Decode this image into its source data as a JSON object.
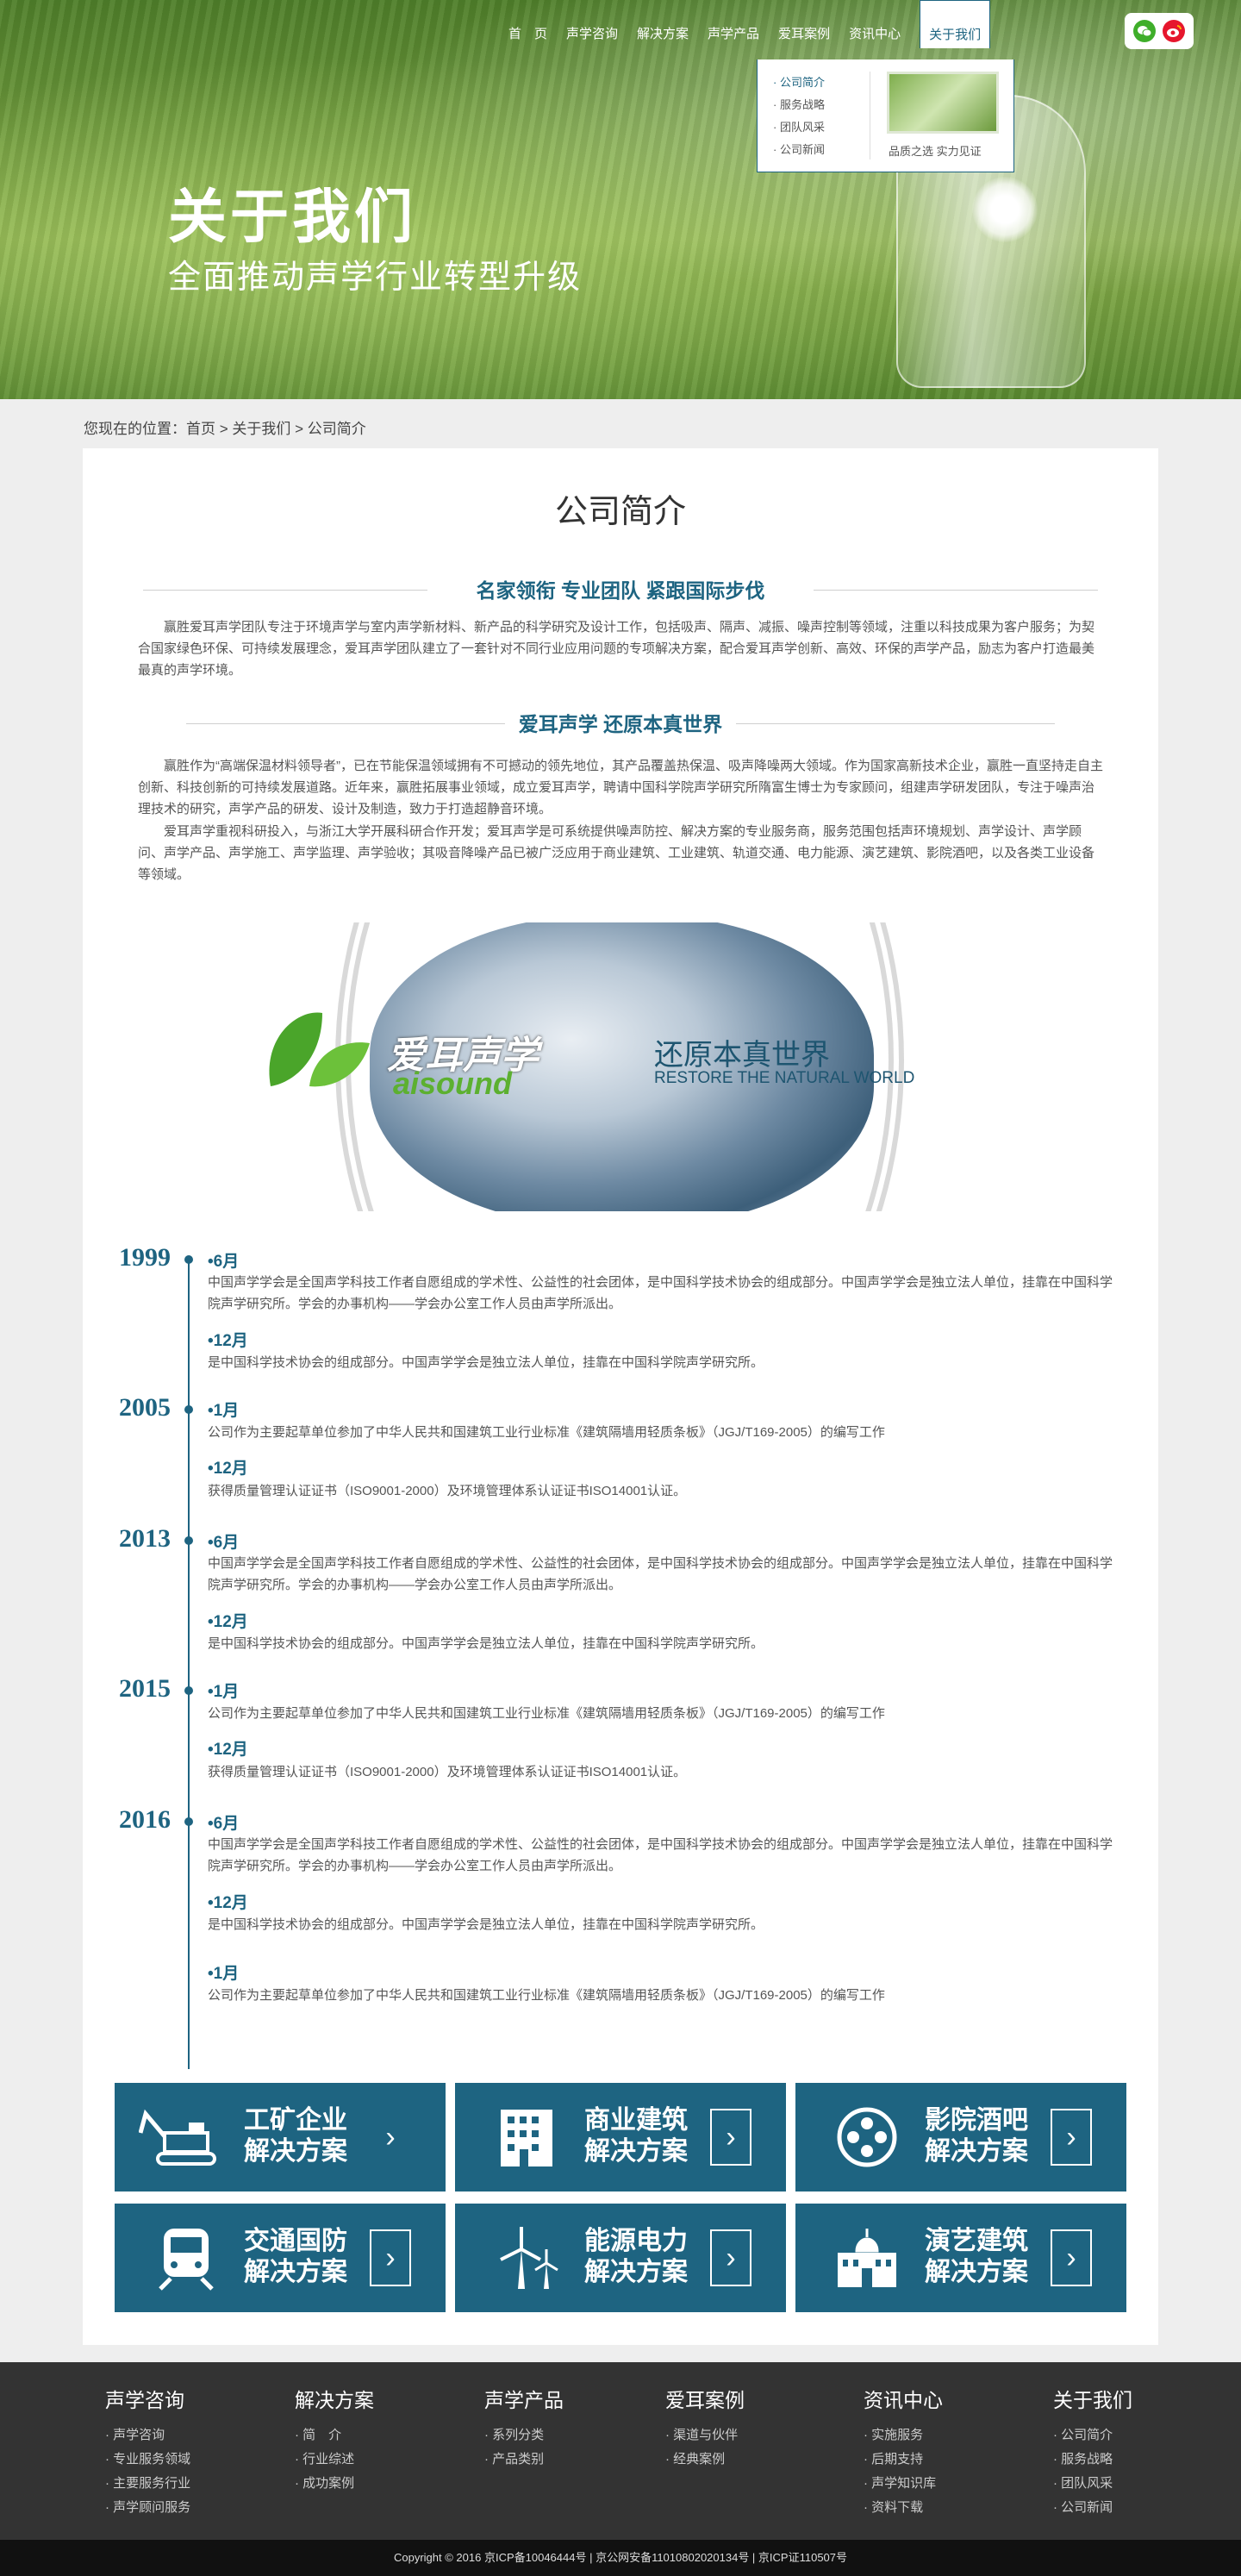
{
  "nav": {
    "items": [
      "首　页",
      "声学咨询",
      "解决方案",
      "声学产品",
      "爱耳案例",
      "资讯中心"
    ],
    "active": "关于我们"
  },
  "dropdown": {
    "items": [
      "公司简介",
      "服务战略",
      "团队风采",
      "公司新闻"
    ],
    "caption": "品质之选 实力见证"
  },
  "social": {
    "wechat_icon": "wechat-icon",
    "weibo_icon": "weibo-icon"
  },
  "hero": {
    "title": "关于我们",
    "subtitle": "全面推动声学行业转型升级"
  },
  "breadcrumb": "您现在的位置：首页 > 关于我们 > 公司简介",
  "page_title": "公司简介",
  "section1": {
    "heading": "名家领衔 专业团队 紧跟国际步伐",
    "text": "赢胜爱耳声学团队专注于环境声学与室内声学新材料、新产品的科学研究及设计工作，包括吸声、隔声、减振、噪声控制等领域，注重以科技成果为客户服务；为契合国家绿色环保、可持续发展理念，爱耳声学团队建立了一套针对不同行业应用问题的专项解决方案，配合爱耳声学创新、高效、环保的声学产品，励志为客户打造最美最真的声学环境。"
  },
  "section2": {
    "heading": "爱耳声学 还原本真世界",
    "text1": "赢胜作为“高端保温材料领导者”，已在节能保温领域拥有不可撼动的领先地位，其产品覆盖热保温、吸声降噪两大领域。作为国家高新技术企业，赢胜一直坚持走自主创新、科技创新的可持续发展道路。近年来，赢胜拓展事业领域，成立爱耳声学，聘请中国科学院声学研究所隋富生博士为专家顾问，组建声学研发团队，专注于噪声治理技术的研究，声学产品的研发、设计及制造，致力于打造超静音环境。",
    "text2": "爱耳声学重视科研投入，与浙江大学开展科研合作开发；爱耳声学是可系统提供噪声防控、解决方案的专业服务商，服务范围包括声环境规划、声学设计、声学顾问、声学产品、声学施工、声学监理、声学验收；其吸音降噪产品已被广泛应用于商业建筑、工业建筑、轨道交通、电力能源、演艺建筑、影院酒吧，以及各类工业设备等领域。"
  },
  "banner": {
    "brand_cn": "爱耳声学",
    "brand_en": "aisound",
    "slogan_cn": "还原本真世界",
    "slogan_en": "RESTORE THE NATURAL WORLD"
  },
  "timeline": [
    {
      "year": "1999",
      "events": [
        {
          "month": "•6月",
          "text": "中国声学学会是全国声学科技工作者自愿组成的学术性、公益性的社会团体，是中国科学技术协会的组成部分。中国声学学会是独立法人单位，挂靠在中国科学院声学研究所。学会的办事机构——学会办公室工作人员由声学所派出。"
        },
        {
          "month": "•12月",
          "text": "是中国科学技术协会的组成部分。中国声学学会是独立法人单位，挂靠在中国科学院声学研究所。"
        }
      ]
    },
    {
      "year": "2005",
      "events": [
        {
          "month": "•1月",
          "text": "公司作为主要起草单位参加了中华人民共和国建筑工业行业标准《建筑隔墙用轻质条板》（JGJ/T169-2005）的编写工作"
        },
        {
          "month": "•12月",
          "text": "获得质量管理认证证书（ISO9001-2000）及环境管理体系认证证书ISO14001认证。"
        }
      ]
    },
    {
      "year": "2013",
      "events": [
        {
          "month": "•6月",
          "text": "中国声学学会是全国声学科技工作者自愿组成的学术性、公益性的社会团体，是中国科学技术协会的组成部分。中国声学学会是独立法人单位，挂靠在中国科学院声学研究所。学会的办事机构——学会办公室工作人员由声学所派出。"
        },
        {
          "month": "•12月",
          "text": "是中国科学技术协会的组成部分。中国声学学会是独立法人单位，挂靠在中国科学院声学研究所。"
        }
      ]
    },
    {
      "year": "2015",
      "events": [
        {
          "month": "•1月",
          "text": "公司作为主要起草单位参加了中华人民共和国建筑工业行业标准《建筑隔墙用轻质条板》（JGJ/T169-2005）的编写工作"
        },
        {
          "month": "•12月",
          "text": "获得质量管理认证证书（ISO9001-2000）及环境管理体系认证证书ISO14001认证。"
        }
      ]
    },
    {
      "year": "2016",
      "events": [
        {
          "month": "•6月",
          "text": "中国声学学会是全国声学科技工作者自愿组成的学术性、公益性的社会团体，是中国科学技术协会的组成部分。中国声学学会是独立法人单位，挂靠在中国科学院声学研究所。学会的办事机构——学会办公室工作人员由声学所派出。"
        },
        {
          "month": "•12月",
          "text": "是中国科学技术协会的组成部分。中国声学学会是独立法人单位，挂靠在中国科学院声学研究所。"
        },
        {
          "month": "•1月",
          "text": "公司作为主要起草单位参加了中华人民共和国建筑工业行业标准《建筑隔墙用轻质条板》（JGJ/T169-2005）的编写工作"
        }
      ]
    }
  ],
  "solutions": [
    {
      "l1": "工矿企业",
      "l2": "解决方案",
      "icon": "excavator-icon"
    },
    {
      "l1": "商业建筑",
      "l2": "解决方案",
      "icon": "building-icon"
    },
    {
      "l1": "影院酒吧",
      "l2": "解决方案",
      "icon": "film-reel-icon"
    },
    {
      "l1": "交通国防",
      "l2": "解决方案",
      "icon": "train-icon"
    },
    {
      "l1": "能源电力",
      "l2": "解决方案",
      "icon": "wind-turbine-icon"
    },
    {
      "l1": "演艺建筑",
      "l2": "解决方案",
      "icon": "theater-icon"
    }
  ],
  "footer": {
    "columns": [
      {
        "title": "声学咨询",
        "items": [
          "声学咨询",
          "专业服务领域",
          "主要服务行业",
          "声学顾问服务"
        ]
      },
      {
        "title": "解决方案",
        "items": [
          "简　介",
          "行业综述",
          "成功案例"
        ]
      },
      {
        "title": "声学产品",
        "items": [
          "系列分类",
          "产品类别"
        ]
      },
      {
        "title": "爱耳案例",
        "items": [
          "渠道与伙伴",
          "经典案例"
        ]
      },
      {
        "title": "资讯中心",
        "items": [
          "实施服务",
          "后期支持",
          "声学知识库",
          "资料下载"
        ]
      },
      {
        "title": "关于我们",
        "items": [
          "公司简介",
          "服务战略",
          "团队风采",
          "公司新闻"
        ]
      }
    ],
    "copyright": "Copyright © 2016  京ICP备10046444号 | 京公网安备11010802020134号 | 京ICP证110507号"
  },
  "colors": {
    "primary": "#1e6481",
    "footer_bg": "#333333",
    "copyright_bg": "#111111"
  }
}
